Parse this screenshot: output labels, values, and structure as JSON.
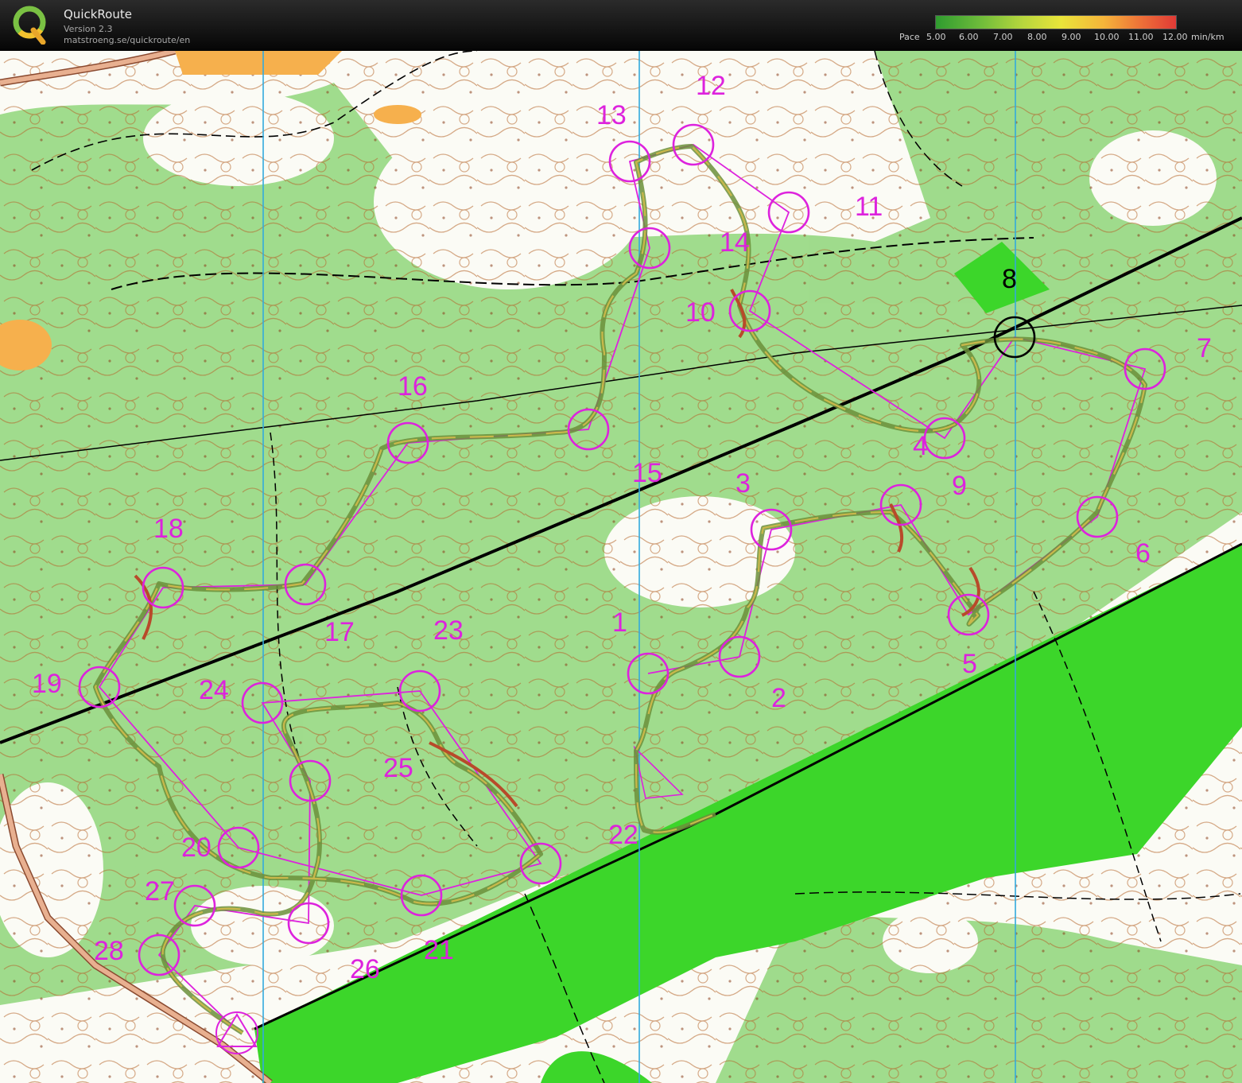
{
  "app": {
    "title": "QuickRoute",
    "version": "Version 2.3",
    "url": "matstroeng.se/quickroute/en",
    "logo_letter": "Q"
  },
  "legend": {
    "label": "Pace",
    "ticks": [
      "5.00",
      "6.00",
      "7.00",
      "8.00",
      "9.00",
      "10.00",
      "11.00",
      "12.00"
    ],
    "unit": "min/km",
    "gradient_colors": [
      "#2f9b2f",
      "#b6d63d",
      "#e9e43a",
      "#f5b43a",
      "#e03a36"
    ]
  },
  "colors": {
    "control": "#dd22dd",
    "route_slow": "#b84a2a",
    "route_fast": "#6b8f3a",
    "forest": "#8fd67a",
    "field": "#3cd62a",
    "road": "#000000",
    "contour": "#b5652b",
    "magnetic_north": "#33aadd"
  },
  "controls": [
    {
      "label": "1"
    },
    {
      "label": "2"
    },
    {
      "label": "3"
    },
    {
      "label": "4"
    },
    {
      "label": "5"
    },
    {
      "label": "6"
    },
    {
      "label": "7"
    },
    {
      "label": "8"
    },
    {
      "label": "9"
    },
    {
      "label": "10"
    },
    {
      "label": "11"
    },
    {
      "label": "12"
    },
    {
      "label": "13"
    },
    {
      "label": "14"
    },
    {
      "label": "15"
    },
    {
      "label": "16"
    },
    {
      "label": "17"
    },
    {
      "label": "18"
    },
    {
      "label": "19"
    },
    {
      "label": "20"
    },
    {
      "label": "21"
    },
    {
      "label": "22"
    },
    {
      "label": "23"
    },
    {
      "label": "24"
    },
    {
      "label": "25"
    },
    {
      "label": "26"
    },
    {
      "label": "27"
    },
    {
      "label": "28"
    }
  ]
}
